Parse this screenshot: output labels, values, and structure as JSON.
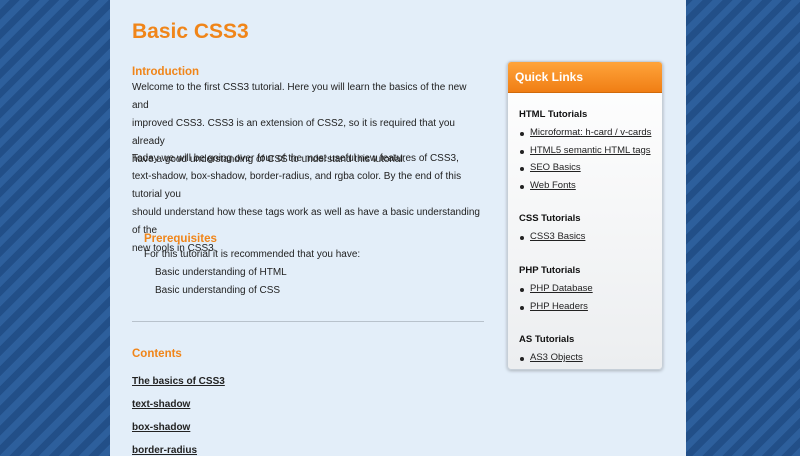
{
  "site": {
    "title": "Basic CSS3"
  },
  "intro": {
    "heading": "Introduction",
    "para1_lines": [
      "Welcome to the first CSS3 tutorial. Here you will learn the basics of the new and",
      "improved CSS3. CSS3 is an extension of CSS2, so it is required that you already",
      "have a good understanding of CSS to understand this tutorial."
    ],
    "para2_lines": [
      "Today we will be going over four of the most useful new features of CSS3,",
      "text-shadow, box-shadow, border-radius, and rgba color. By the end of this tutorial you",
      "should understand how these tags work as well as have a basic understanding of the",
      "new tools in CSS3."
    ]
  },
  "prerequisites": {
    "heading": "Prerequisites",
    "intro": "For this tutorial it is recommended that you have:",
    "items": [
      "Basic understanding of HTML",
      "Basic understanding of CSS"
    ]
  },
  "contents": {
    "heading": "Contents",
    "items": [
      "The basics of CSS3",
      "text-shadow",
      "box-shadow",
      "border-radius"
    ]
  },
  "quick_links": {
    "title": "Quick Links",
    "groups": [
      {
        "title": "HTML Tutorials",
        "links": [
          "Microformat: h-card / v-cards",
          "HTML5 semantic HTML tags",
          "SEO Basics",
          "Web Fonts"
        ]
      },
      {
        "title": "CSS Tutorials",
        "links": [
          "CSS3 Basics"
        ]
      },
      {
        "title": "PHP Tutorials",
        "links": [
          "PHP Database",
          "PHP Headers"
        ]
      },
      {
        "title": "AS Tutorials",
        "links": [
          "AS3 Objects"
        ]
      }
    ]
  },
  "colors": {
    "accent": "#f08519",
    "page_bg": "#e3eef9",
    "outer_bg": "#2a5a95"
  }
}
